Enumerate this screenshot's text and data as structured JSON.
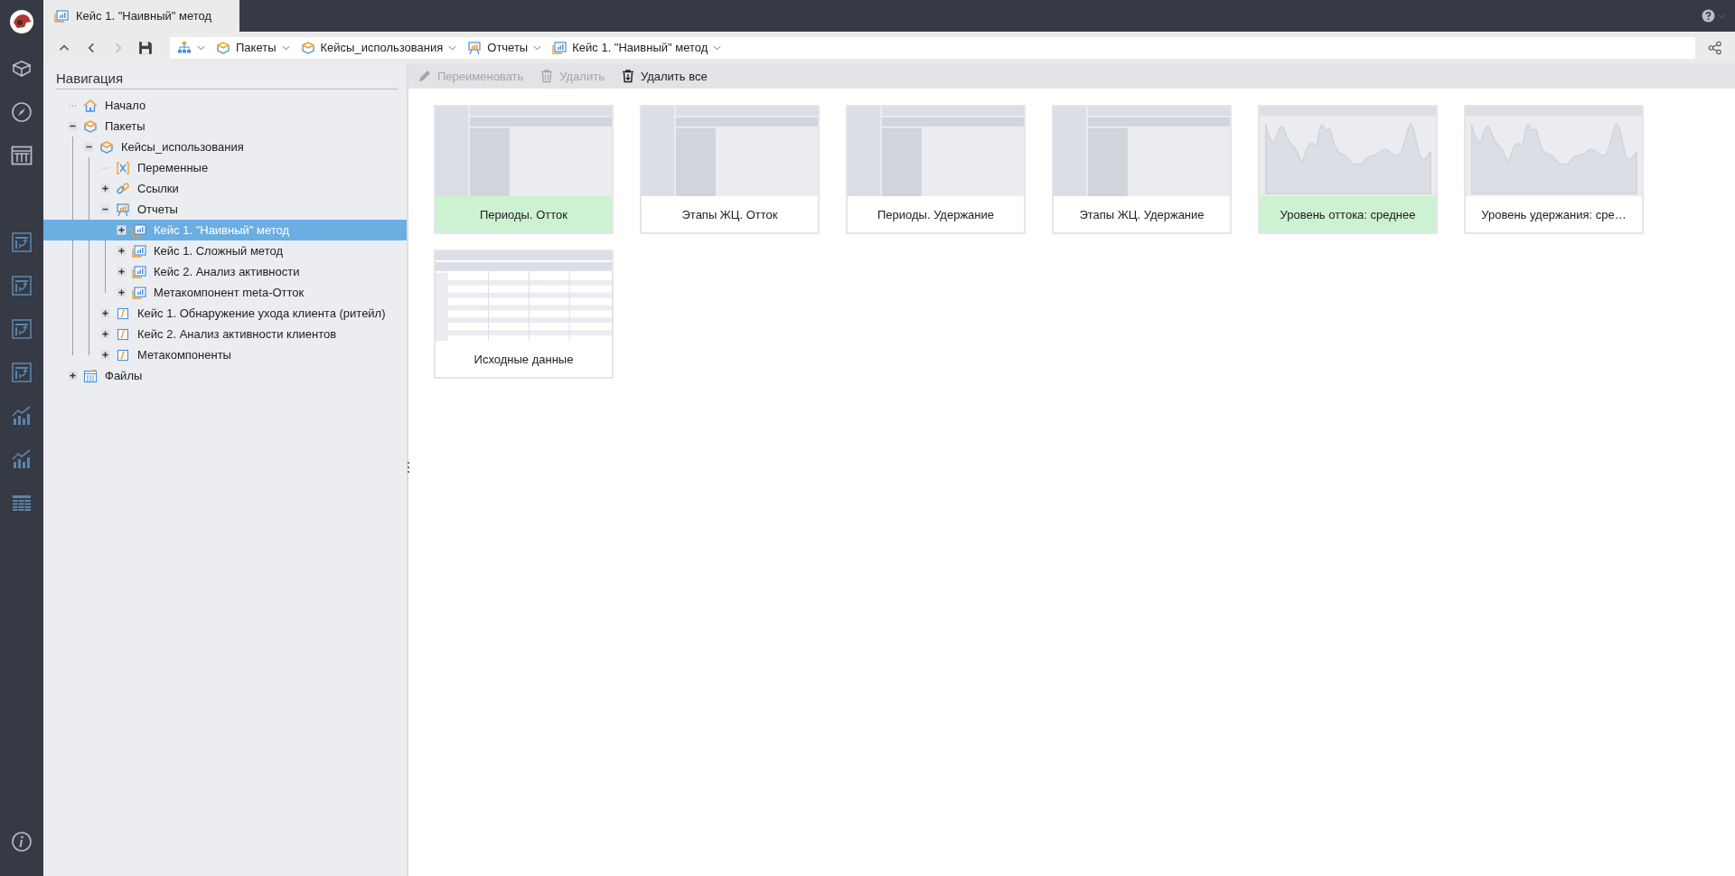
{
  "tab": {
    "title": "Кейс 1. \"Наивный\" метод"
  },
  "breadcrumbs": [
    {
      "kind": "hierarchy"
    },
    {
      "kind": "package",
      "label": "Пакеты"
    },
    {
      "kind": "package",
      "label": "Кейсы_использования"
    },
    {
      "kind": "reports",
      "label": "Отчеты"
    },
    {
      "kind": "report",
      "label": "Кейс 1. \"Наивный\" метод"
    }
  ],
  "navigation": {
    "title": "Навигация",
    "tree": [
      {
        "label": "Начало",
        "kind": "home",
        "expandable": false,
        "selected": false
      },
      {
        "label": "Пакеты",
        "kind": "package",
        "expandable": true,
        "expanded": true,
        "selected": false,
        "children": [
          {
            "label": "Кейсы_использования",
            "kind": "package",
            "expandable": true,
            "expanded": true,
            "selected": false,
            "children": [
              {
                "label": "Переменные",
                "kind": "variables",
                "expandable": false,
                "selected": false
              },
              {
                "label": "Ссылки",
                "kind": "link",
                "expandable": true,
                "expanded": false,
                "selected": false
              },
              {
                "label": "Отчеты",
                "kind": "reports",
                "expandable": true,
                "expanded": true,
                "selected": false,
                "children": [
                  {
                    "label": "Кейс 1. \"Наивный\" метод",
                    "kind": "report",
                    "expandable": true,
                    "expanded": false,
                    "selected": true
                  },
                  {
                    "label": "Кейс 1. Сложный метод",
                    "kind": "report",
                    "expandable": true,
                    "expanded": false,
                    "selected": false
                  },
                  {
                    "label": "Кейс 2. Анализ активности",
                    "kind": "report",
                    "expandable": true,
                    "expanded": false,
                    "selected": false
                  },
                  {
                    "label": "Метакомпонент meta-Отток",
                    "kind": "report",
                    "expandable": true,
                    "expanded": false,
                    "selected": false
                  }
                ]
              },
              {
                "label": "Кейс 1. Обнаружение ухода клиента (ритейл)",
                "kind": "formula",
                "expandable": true,
                "expanded": false,
                "selected": false
              },
              {
                "label": "Кейс 2. Анализ активности клиентов",
                "kind": "formula",
                "expandable": true,
                "expanded": false,
                "selected": false
              },
              {
                "label": "Метакомпоненты",
                "kind": "formula",
                "expandable": true,
                "expanded": false,
                "selected": false
              }
            ]
          }
        ]
      },
      {
        "label": "Файлы",
        "kind": "files",
        "expandable": true,
        "expanded": false,
        "selected": false
      }
    ]
  },
  "toolbar": [
    {
      "label": "Переименовать",
      "kind": "pencil",
      "disabled": true
    },
    {
      "label": "Удалить",
      "kind": "trash",
      "disabled": true
    },
    {
      "label": "Удалить все",
      "kind": "trash-all",
      "disabled": false
    }
  ],
  "cards": [
    {
      "label": "Периоды. Отток",
      "kind": "pivot",
      "highlighted": true
    },
    {
      "label": "Этапы ЖЦ. Отток",
      "kind": "pivot",
      "highlighted": false
    },
    {
      "label": "Периоды. Удержание",
      "kind": "pivot",
      "highlighted": false
    },
    {
      "label": "Этапы ЖЦ. Удержание",
      "kind": "pivot",
      "highlighted": false
    },
    {
      "label": "Уровень оттока: среднее",
      "kind": "chart",
      "highlighted": true
    },
    {
      "label": "Уровень удержания: сре…",
      "kind": "chart",
      "highlighted": false
    },
    {
      "label": "Исходные данные",
      "kind": "table",
      "highlighted": false
    }
  ]
}
